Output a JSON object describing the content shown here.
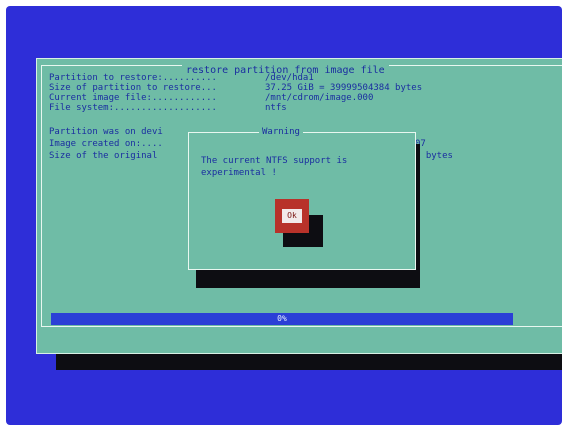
{
  "main_dialog": {
    "title": "restore partition from image file",
    "rows": [
      {
        "label": "Partition to restore:..........",
        "value": "/dev/hda1"
      },
      {
        "label": "Size of partition to restore...",
        "value": "37.25 GiB = 39999504384 bytes"
      },
      {
        "label": "Current image file:............",
        "value": "/mnt/cdrom/image.000"
      },
      {
        "label": "File system:...................",
        "value": "ntfs"
      }
    ],
    "lower_rows": [
      {
        "label": "Partition was on devi",
        "value": ""
      },
      {
        "label": "Image created on:....",
        "value": "07"
      },
      {
        "label": "Size of the original",
        "value": "4 bytes"
      }
    ],
    "status_bar_text": "0%"
  },
  "warning_dialog": {
    "title": "Warning",
    "message": "The current NTFS support is experimental !",
    "ok_label": "Ok"
  }
}
